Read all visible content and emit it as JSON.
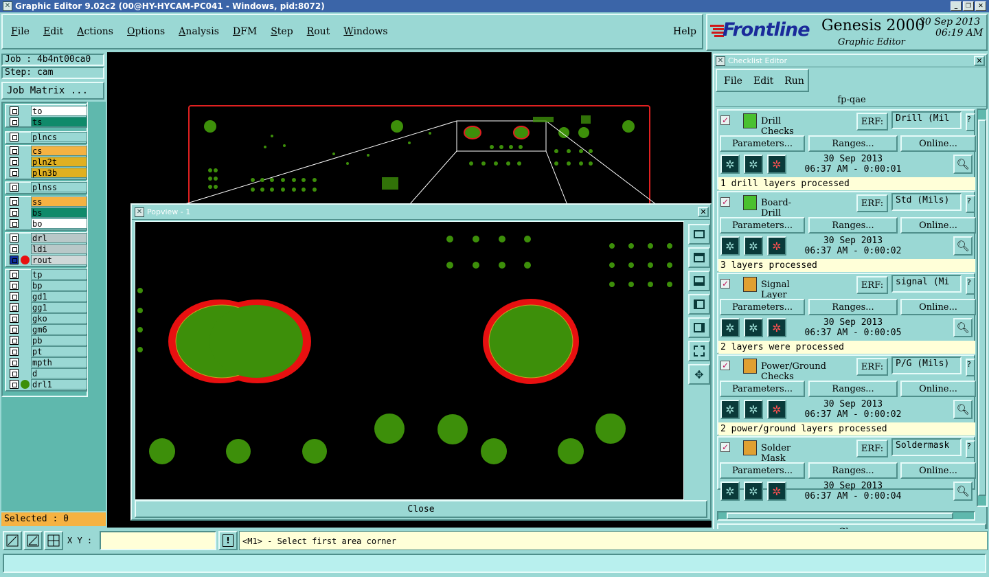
{
  "window": {
    "title": "Graphic Editor 9.02c2 (00@HY-HYCAM-PC041 - Windows, pid:8072)"
  },
  "menu": [
    "File",
    "Edit",
    "Actions",
    "Options",
    "Analysis",
    "DFM",
    "Step",
    "Rout",
    "Windows"
  ],
  "help": "Help",
  "brand": {
    "logo": "Frontline",
    "product": "Genesis 2000",
    "subtitle": "Graphic Editor",
    "date": "30 Sep 2013",
    "time": "06:19 AM"
  },
  "job": {
    "job_label": "Job : 4b4nt00ca0",
    "step_label": "Step: cam",
    "matrix_button": "Job Matrix ..."
  },
  "layers": [
    {
      "name": "to",
      "color": "#ffffff"
    },
    {
      "name": "ts",
      "color": "#0f8a6a"
    },
    {
      "name": "plncs",
      "color": "#9ad8d4"
    },
    {
      "name": "cs",
      "color": "#f5b242"
    },
    {
      "name": "pln2t",
      "color": "#e0b020"
    },
    {
      "name": "pln3b",
      "color": "#e0b020"
    },
    {
      "name": "plnss",
      "color": "#9ad8d4"
    },
    {
      "name": "ss",
      "color": "#f5b242"
    },
    {
      "name": "bs",
      "color": "#0f8a6a"
    },
    {
      "name": "bo",
      "color": "#ffffff"
    },
    {
      "name": "drl",
      "color": "#b8c8c8"
    },
    {
      "name": "ldi",
      "color": "#b8c8c8"
    },
    {
      "name": "rout",
      "color": "#cfd8d8"
    },
    {
      "name": "tp",
      "color": "#9ad8d4"
    },
    {
      "name": "bp",
      "color": "#9ad8d4"
    },
    {
      "name": "gd1",
      "color": "#9ad8d4"
    },
    {
      "name": "gg1",
      "color": "#9ad8d4"
    },
    {
      "name": "gko",
      "color": "#9ad8d4"
    },
    {
      "name": "gm6",
      "color": "#9ad8d4"
    },
    {
      "name": "pb",
      "color": "#9ad8d4"
    },
    {
      "name": "pt",
      "color": "#9ad8d4"
    },
    {
      "name": "mpth",
      "color": "#9ad8d4"
    },
    {
      "name": "d",
      "color": "#9ad8d4"
    },
    {
      "name": "drl1",
      "color": "#9ad8d4"
    }
  ],
  "selected": "Selected : 0",
  "bottom": {
    "xy_label": "X Y :",
    "xy_value": "",
    "prompt": "<M1> - Select first area corner"
  },
  "popview": {
    "title": "Popview - 1",
    "close": "Close"
  },
  "checklist": {
    "title": "Checklist Editor",
    "menu": [
      "File",
      "Edit",
      "Run"
    ],
    "name": "fp-qae",
    "erf_label": "ERF:",
    "btn_params": "Parameters...",
    "btn_ranges": "Ranges...",
    "btn_online": "Online...",
    "close": "Close",
    "checks": [
      {
        "name": "Drill Checks",
        "erf": "Drill (Mil",
        "date": "30 Sep 2013",
        "time": "06:37 AM - 0:00:01",
        "status": "1 drill layers processed"
      },
      {
        "name": "Board-Drill Checks",
        "erf": "Std (Mils)",
        "date": "30 Sep 2013",
        "time": "06:37 AM - 0:00:02",
        "status": "3 layers processed"
      },
      {
        "name": "Signal Layer Checks",
        "erf": "signal (Mi",
        "date": "30 Sep 2013",
        "time": "06:37 AM - 0:00:05",
        "status": "2 layers were processed"
      },
      {
        "name": "Power/Ground Checks",
        "erf": "P/G (Mils)",
        "date": "30 Sep 2013",
        "time": "06:37 AM - 0:00:02",
        "status": "2 power/ground layers processed"
      },
      {
        "name": "Solder Mask Checks",
        "erf": "Soldermask",
        "date": "30 Sep 2013",
        "time": "06:37 AM - 0:00:04",
        "status": ""
      }
    ]
  }
}
